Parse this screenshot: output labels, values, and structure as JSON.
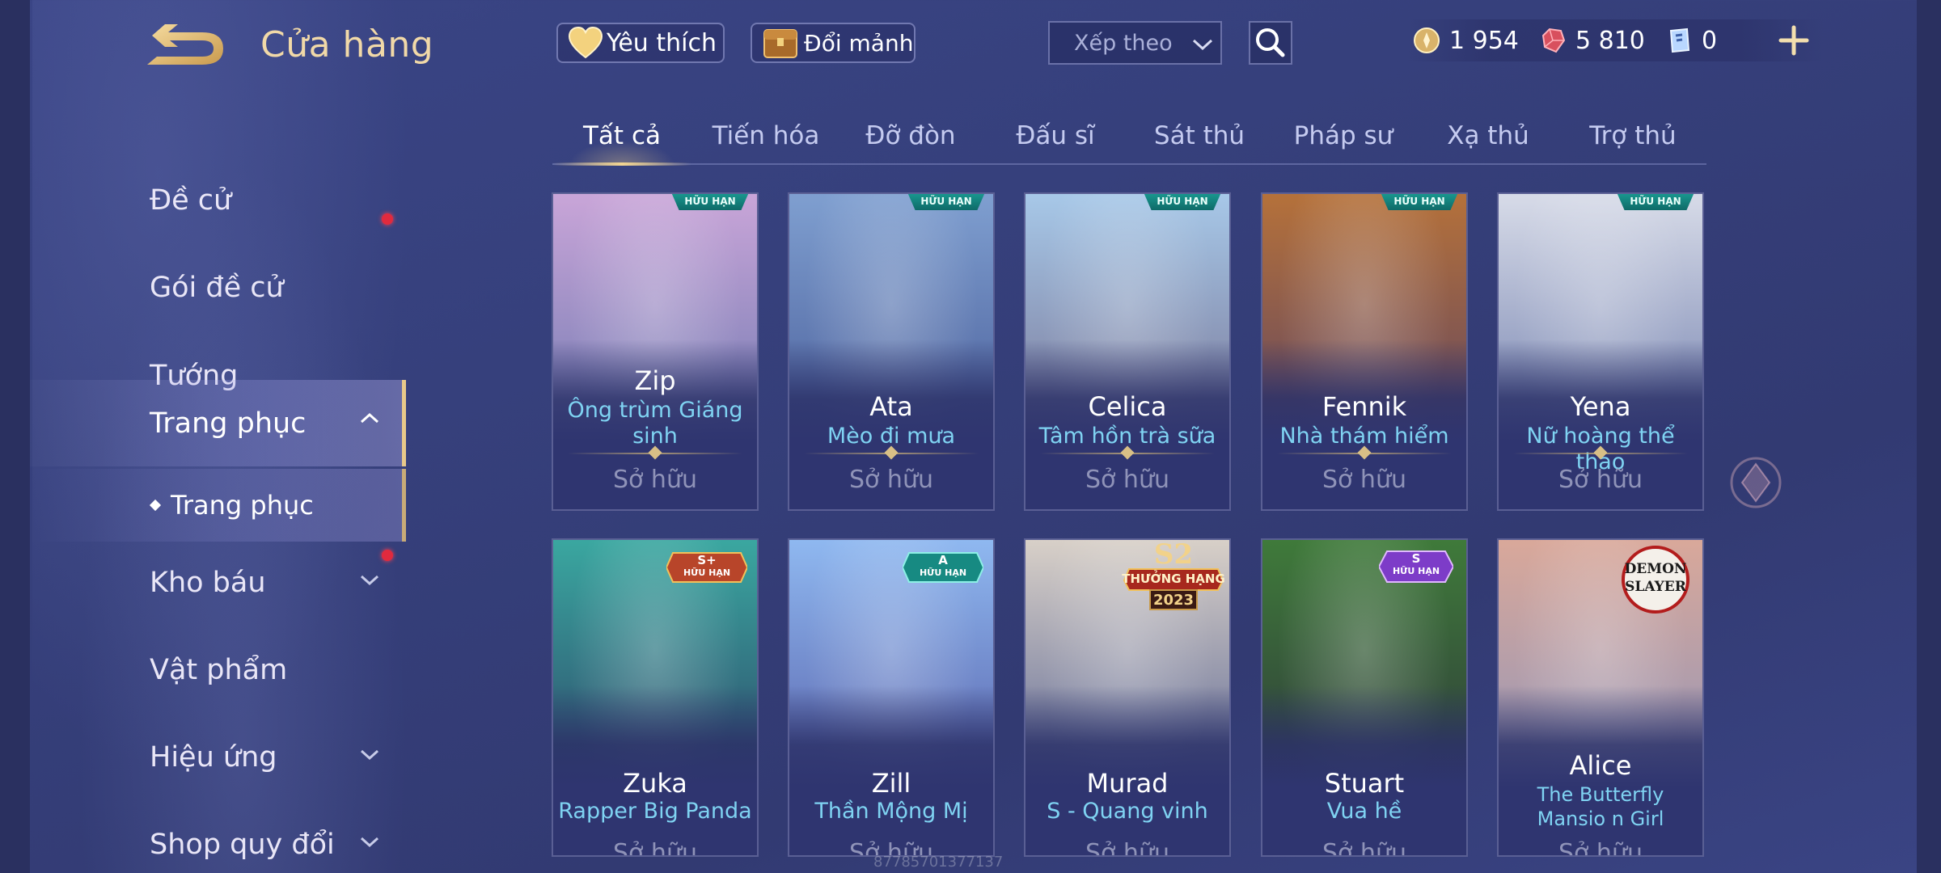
{
  "header": {
    "title": "Cửa hàng",
    "favorites_label": "Yêu thích",
    "exchange_label": "Đổi mảnh",
    "sort_placeholder": "Xếp theo"
  },
  "currency": {
    "gold": "1 954",
    "gems": "5 810",
    "vouchers": "0"
  },
  "sidebar": {
    "items": [
      {
        "label": "Đề cử"
      },
      {
        "label": "Gói đề cử"
      },
      {
        "label": "Tướng"
      },
      {
        "label": "Trang phục"
      },
      {
        "label": "Kho báu"
      },
      {
        "label": "Vật phẩm"
      },
      {
        "label": "Hiệu ứng"
      },
      {
        "label": "Shop quy đổi"
      }
    ],
    "sub_item": "Trang phục"
  },
  "tabs": [
    "Tất cả",
    "Tiến hóa",
    "Đỡ đòn",
    "Đấu sĩ",
    "Sát thủ",
    "Pháp sư",
    "Xạ thủ",
    "Trợ thủ"
  ],
  "badges": {
    "limited": "HỮU HẠN",
    "tier_splus": "S+",
    "tier_a": "A",
    "tier_s": "S",
    "s2_top": "S2",
    "s2_mid": "THƯỞNG HẠNG",
    "s2_year": "2023",
    "demon_top": "DEMON",
    "demon_bottom": "SLAYER"
  },
  "cards": [
    {
      "hero": "Zip",
      "skin": "Ông trùm Giáng sinh",
      "status": "Sở hữu",
      "color_top": "#c9a5d8",
      "color_bottom": "#5a6fa8"
    },
    {
      "hero": "Ata",
      "skin": "Mèo đi mưa",
      "status": "Sở hữu",
      "color_top": "#7f9fd0",
      "color_bottom": "#3c4d8c"
    },
    {
      "hero": "Celica",
      "skin": "Tâm hồn trà sữa",
      "status": "Sở hữu",
      "color_top": "#a7c8e8",
      "color_bottom": "#6b5f80"
    },
    {
      "hero": "Fennik",
      "skin": "Nhà thám hiểm",
      "status": "Sở hữu",
      "color_top": "#b5713a",
      "color_bottom": "#4b3a6a"
    },
    {
      "hero": "Yena",
      "skin": "Nữ hoàng thể thao",
      "status": "Sở hữu",
      "color_top": "#d7dbe8",
      "color_bottom": "#5a6aa0"
    },
    {
      "hero": "Zuka",
      "skin": "Rapper Big Panda",
      "status": "Sở hữu",
      "color_top": "#3aa7a0",
      "color_bottom": "#2a2f5a"
    },
    {
      "hero": "Zill",
      "skin": "Thần Mộng Mị",
      "status": "Sở hữu",
      "color_top": "#8fb8f0",
      "color_bottom": "#4a4c9a"
    },
    {
      "hero": "Murad",
      "skin": "S - Quang vinh",
      "status": "Sở hữu",
      "color_top": "#d8d0c8",
      "color_bottom": "#3f4e88"
    },
    {
      "hero": "Stuart",
      "skin": "Vua hề",
      "status": "Sở hữu",
      "color_top": "#3f7a3a",
      "color_bottom": "#2a2a3a"
    },
    {
      "hero": "Alice",
      "skin": "The Butterfly Mansio n Girl",
      "status": "Sở hữu",
      "color_top": "#d9a89a",
      "color_bottom": "#8090c0"
    }
  ],
  "watermark": "877857013771​37"
}
